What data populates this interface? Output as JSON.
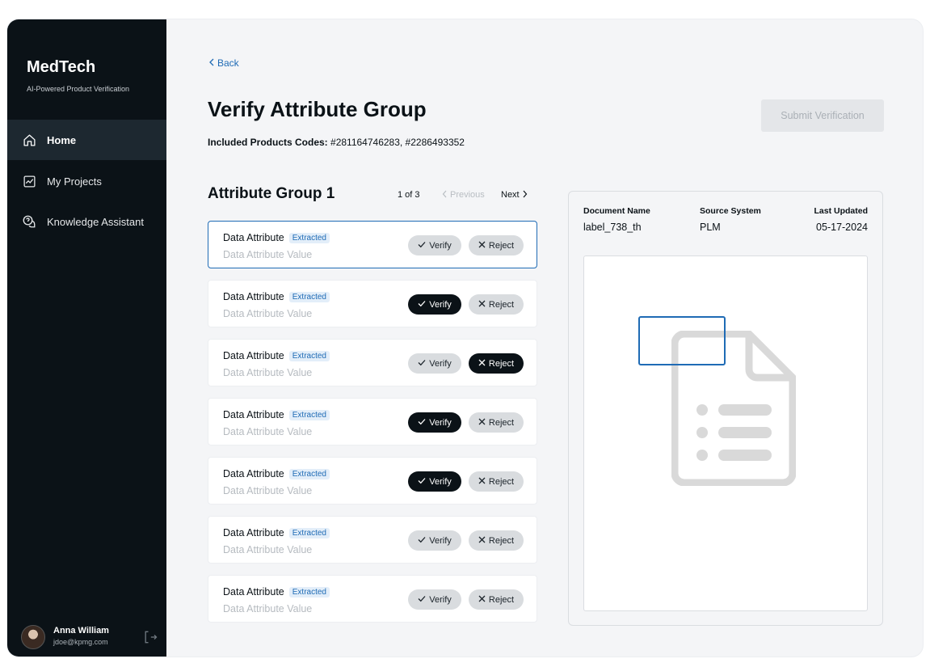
{
  "sidebar": {
    "brand": "MedTech",
    "subtitle": "AI-Powered Product Verification",
    "items": [
      {
        "label": "Home",
        "icon": "home-icon",
        "active": true
      },
      {
        "label": "My Projects",
        "icon": "chart-icon",
        "active": false
      },
      {
        "label": "Knowledge Assistant",
        "icon": "chat-question-icon",
        "active": false
      }
    ],
    "user": {
      "name": "Anna William",
      "email": "jdoe@kpmg.com"
    }
  },
  "header": {
    "back_label": "Back",
    "title": "Verify Attribute Group",
    "codes_label": "Included Products Codes:",
    "codes_value": " #281164746283, #2286493352",
    "submit_label": "Submit Verification"
  },
  "group": {
    "title": "Attribute Group 1",
    "pager": {
      "count": "1 of 3",
      "prev": "Previous",
      "next": "Next"
    },
    "attributes": [
      {
        "name": "Data Attribute",
        "badge": "Extracted",
        "value": "Data Attribute Value",
        "verify": "Verify",
        "reject": "Reject",
        "state": "none",
        "selected": true
      },
      {
        "name": "Data Attribute",
        "badge": "Extracted",
        "value": "Data Attribute Value",
        "verify": "Verify",
        "reject": "Reject",
        "state": "verified",
        "selected": false
      },
      {
        "name": "Data Attribute",
        "badge": "Extracted",
        "value": "Data Attribute Value",
        "verify": "Verify",
        "reject": "Reject",
        "state": "rejected",
        "selected": false
      },
      {
        "name": "Data Attribute",
        "badge": "Extracted",
        "value": "Data Attribute Value",
        "verify": "Verify",
        "reject": "Reject",
        "state": "verified",
        "selected": false
      },
      {
        "name": "Data Attribute",
        "badge": "Extracted",
        "value": "Data Attribute Value",
        "verify": "Verify",
        "reject": "Reject",
        "state": "verified",
        "selected": false
      },
      {
        "name": "Data Attribute",
        "badge": "Extracted",
        "value": "Data Attribute Value",
        "verify": "Verify",
        "reject": "Reject",
        "state": "none",
        "selected": false
      },
      {
        "name": "Data Attribute",
        "badge": "Extracted",
        "value": "Data Attribute Value",
        "verify": "Verify",
        "reject": "Reject",
        "state": "none",
        "selected": false
      }
    ]
  },
  "document": {
    "name_label": "Document Name",
    "name_value": "label_738_th",
    "source_label": "Source System",
    "source_value": "PLM",
    "updated_label": "Last Updated",
    "updated_value": "05-17-2024",
    "icon": "document-icon"
  },
  "colors": {
    "sidebar_bg": "#0b1217",
    "accent": "#1f6bb5",
    "badge_bg": "#e3eef9",
    "button_dark": "#0b1217",
    "button_neutral": "#d9dcdf"
  }
}
